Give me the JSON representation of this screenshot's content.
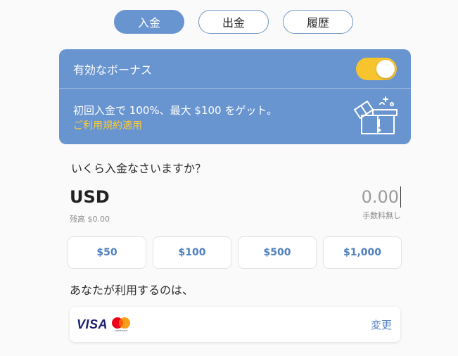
{
  "tabs": [
    {
      "label": "入金",
      "active": true
    },
    {
      "label": "出金",
      "active": false
    },
    {
      "label": "履歴",
      "active": false
    }
  ],
  "bonus": {
    "title": "有効なボーナス",
    "toggle_on": true,
    "description": "初回入金で 100%、最大 $100 をゲット。",
    "terms_link": "ご利用規約適用",
    "icon": "gift-icon"
  },
  "deposit": {
    "question": "いくら入金なさいますか？",
    "currency": "USD",
    "balance": "残高 $0.00",
    "amount_placeholder": "0.00",
    "fee_note": "手数料無し"
  },
  "presets": [
    "$50",
    "$100",
    "$500",
    "$1,000"
  ],
  "payment": {
    "label": "あなたが利用するのは、",
    "brand_visa": "VISA",
    "brand_mastercard_text": "mastercard",
    "change_label": "変更"
  },
  "colors": {
    "accent": "#6894cf",
    "toggle": "#f7c42e",
    "terms": "#ffcc33",
    "link": "#5a86c4"
  }
}
